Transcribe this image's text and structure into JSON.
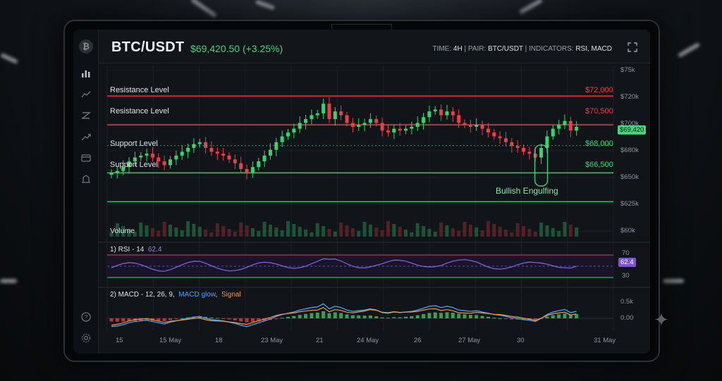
{
  "header": {
    "pair": "BTC/USDT",
    "price_change": "$69,420.50 (+3.25%)",
    "time_label": "TIME:",
    "time_value": "4H",
    "pair_label": "| PAIR:",
    "pair_value": "BTC/USDT",
    "indicators_label": "| INDICATORS:",
    "indicators_value": "RSI, MACD"
  },
  "sidebar": {
    "items": [
      "bitcoin-logo",
      "bar-chart-icon",
      "line-chart-icon",
      "candles-icon",
      "trend-icon",
      "wallet-icon",
      "alerts-icon"
    ],
    "bottom": [
      "help-icon",
      "settings-icon"
    ]
  },
  "levels": [
    {
      "label": "Resistance Level",
      "price": "$72,000",
      "color": "#e8404a"
    },
    {
      "label": "Resistance Level",
      "price": "$70,500",
      "color": "#e8404a"
    },
    {
      "label": "Support Level",
      "price": "$68,000",
      "color": "#3fd06e"
    },
    {
      "label": "Support Level",
      "price": "$66,500",
      "color": "#3fd06e"
    }
  ],
  "price_axis": [
    "$75k",
    "$720k",
    "$700k",
    "$680k",
    "$650k",
    "$625k",
    "$60k"
  ],
  "current_price_tag": "$69,420",
  "pattern_label": "Bullish Engulfing",
  "volume_label": "Volume",
  "rsi": {
    "title": "1) RSI - 14",
    "value": "62.4",
    "axis": [
      "70",
      "30"
    ],
    "tag": "62.4"
  },
  "macd": {
    "title": "2) MACD - 12, 26, 9,",
    "macd_label": "MACD glow",
    "signal_label": "Signal",
    "axis": [
      "0.5k",
      "0.00"
    ]
  },
  "x_axis": [
    "15",
    "15 May",
    "18",
    "23 May",
    "21",
    "24 May",
    "26",
    "27 May",
    "30",
    "31 May"
  ],
  "colors": {
    "bull": "#3fd06e",
    "bear": "#e8404a",
    "rsi": "#8b64e0",
    "macd": "#4aa3ff",
    "signal": "#f39a3b"
  },
  "chart_data": {
    "type": "candlestick",
    "closes": [
      68.0,
      68.1,
      68.3,
      68.6,
      68.8,
      68.9,
      69.0,
      68.8,
      68.6,
      68.4,
      68.7,
      68.9,
      69.1,
      69.3,
      69.5,
      69.6,
      69.3,
      69.1,
      69.0,
      68.9,
      68.7,
      68.5,
      68.2,
      68.0,
      68.3,
      68.6,
      68.9,
      69.2,
      69.6,
      69.9,
      70.1,
      70.3,
      70.6,
      70.8,
      71.0,
      71.1,
      71.6,
      70.8,
      71.2,
      71.0,
      70.6,
      70.4,
      70.5,
      70.6,
      70.8,
      70.6,
      70.2,
      70.1,
      70.3,
      70.2,
      70.3,
      70.4,
      70.6,
      70.9,
      71.2,
      71.3,
      71.0,
      71.2,
      71.0,
      70.6,
      70.5,
      70.4,
      70.5,
      70.3,
      70.1,
      69.9,
      69.8,
      69.6,
      69.4,
      69.3,
      69.1,
      69.0,
      68.8,
      69.3,
      69.9,
      70.3,
      70.5,
      70.7,
      70.2,
      70.4
    ],
    "support": [
      68000,
      66500
    ],
    "resistance": [
      72000,
      70500
    ],
    "current": 69420.5
  }
}
